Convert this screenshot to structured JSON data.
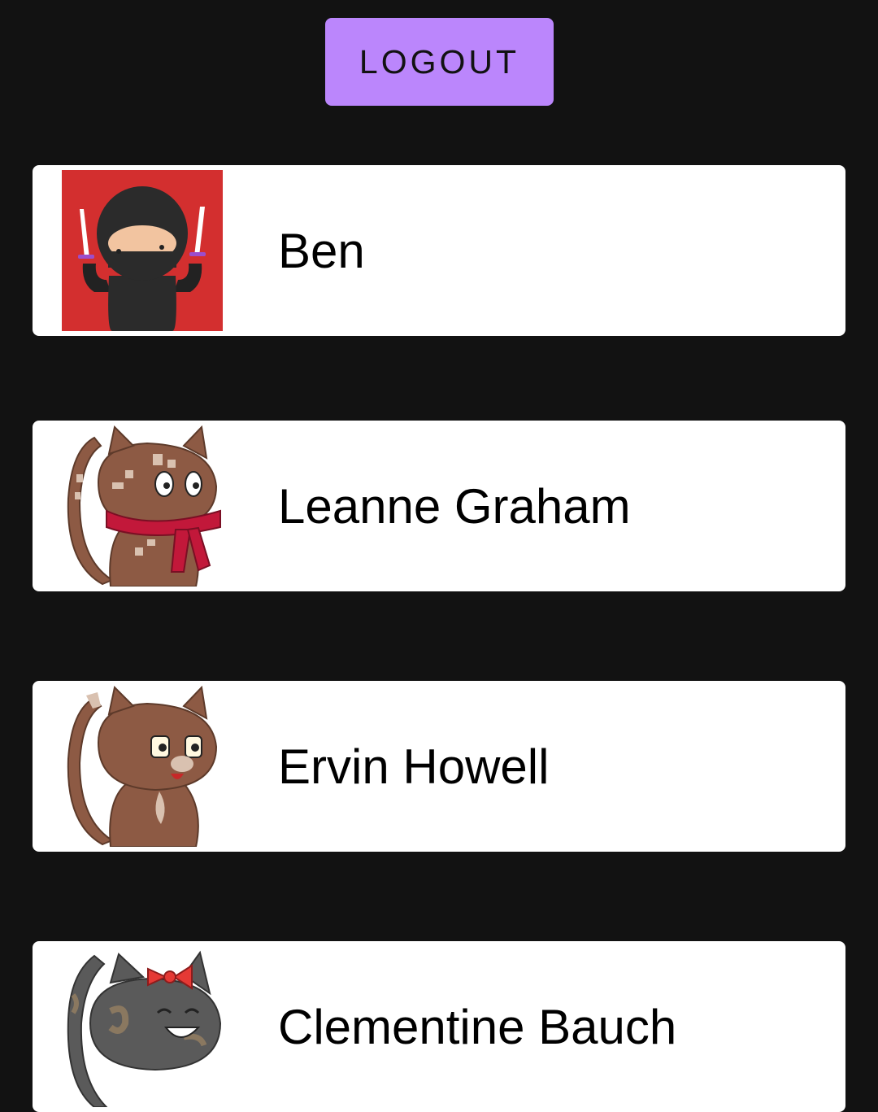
{
  "header": {
    "logout_label": "LOGOUT"
  },
  "colors": {
    "background": "#121212",
    "accent": "#bb86fc",
    "card": "#ffffff",
    "text": "#000000"
  },
  "users": [
    {
      "name": "Ben",
      "avatar_icon": "ninja-avatar-icon"
    },
    {
      "name": "Leanne Graham",
      "avatar_icon": "cat-with-scarf-avatar-icon"
    },
    {
      "name": "Ervin Howell",
      "avatar_icon": "brown-cat-avatar-icon"
    },
    {
      "name": "Clementine Bauch",
      "avatar_icon": "gray-cat-with-bow-avatar-icon"
    }
  ]
}
